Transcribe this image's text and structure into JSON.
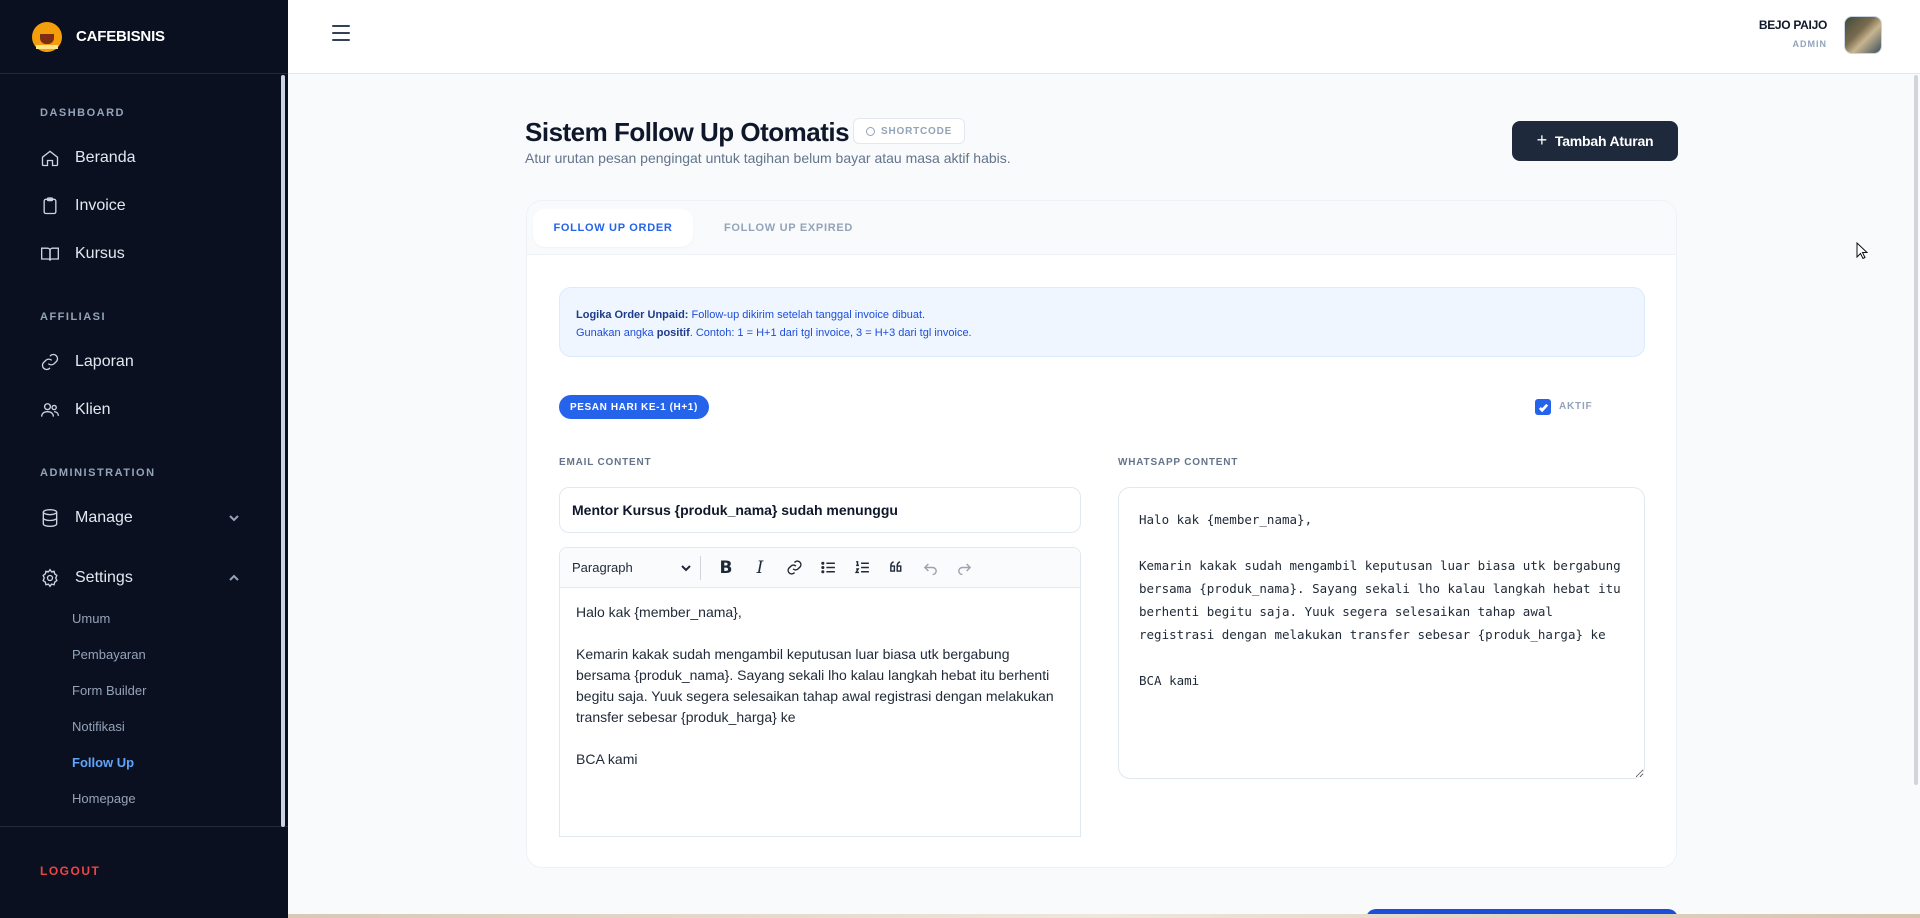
{
  "app": {
    "name": "CAFEBISNIS"
  },
  "user": {
    "name": "BEJO PAIJO",
    "role": "ADMIN"
  },
  "sidebar": {
    "sections": [
      {
        "label": "DASHBOARD",
        "items": [
          {
            "label": "Beranda",
            "icon": "home-icon"
          },
          {
            "label": "Invoice",
            "icon": "clipboard-icon"
          },
          {
            "label": "Kursus",
            "icon": "book-icon"
          }
        ]
      },
      {
        "label": "AFFILIASI",
        "items": [
          {
            "label": "Laporan",
            "icon": "link-icon"
          },
          {
            "label": "Klien",
            "icon": "users-icon"
          }
        ]
      },
      {
        "label": "ADMINISTRATION",
        "items": [
          {
            "label": "Manage",
            "icon": "database-icon"
          },
          {
            "label": "Settings",
            "icon": "gear-icon"
          }
        ]
      }
    ],
    "settings_sub": [
      "Umum",
      "Pembayaran",
      "Form Builder",
      "Notifikasi",
      "Follow Up",
      "Homepage"
    ],
    "active_sub": "Follow Up",
    "logout": "LOGOUT"
  },
  "page": {
    "title": "Sistem Follow Up Otomatis",
    "shortcode_label": "SHORTCODE",
    "subtitle": "Atur urutan pesan pengingat untuk tagihan belum bayar atau masa aktif habis.",
    "add_button": "Tambah Aturan"
  },
  "tabs": [
    {
      "label": "FOLLOW UP ORDER",
      "active": true
    },
    {
      "label": "FOLLOW UP EXPIRED",
      "active": false
    }
  ],
  "info": {
    "line1_bold": "Logika Order Unpaid:",
    "line1_text": " Follow-up dikirim setelah tanggal invoice dibuat.",
    "line2_pre": "Gunakan angka ",
    "line2_bold": "positif",
    "line2_text": ". Contoh: 1 = H+1 dari tgl invoice, 3 = H+3 dari tgl invoice."
  },
  "rule": {
    "badge": "PESAN HARI KE-1 (H+1)",
    "active_label": "AKTIF",
    "active": true,
    "email_label": "EMAIL CONTENT",
    "whatsapp_label": "WHATSAPP CONTENT",
    "email_subject": "Mentor Kursus {produk_nama} sudah menunggu",
    "editor_block_type": "Paragraph",
    "email_body": [
      "Halo kak {member_nama},",
      "",
      "Kemarin kakak sudah mengambil keputusan luar biasa utk bergabung bersama {produk_nama}. Sayang sekali lho kalau langkah hebat itu berhenti begitu saja. Yuuk segera selesaikan tahap awal registrasi dengan melakukan transfer sebesar {produk_harga} ke",
      "",
      "BCA kami"
    ],
    "whatsapp_body": "Halo kak {member_nama},\n\nKemarin kakak sudah mengambil keputusan luar biasa utk bergabung bersama {produk_nama}. Sayang sekali lho kalau langkah hebat itu berhenti begitu saja. Yuuk segera selesaikan tahap awal registrasi dengan melakukan transfer sebesar {produk_harga} ke\n\nBCA kami"
  },
  "colors": {
    "sidebar_bg": "#0b1020",
    "accent": "#2563eb",
    "logout": "#ef4444",
    "primary_button": "#1e293b"
  }
}
